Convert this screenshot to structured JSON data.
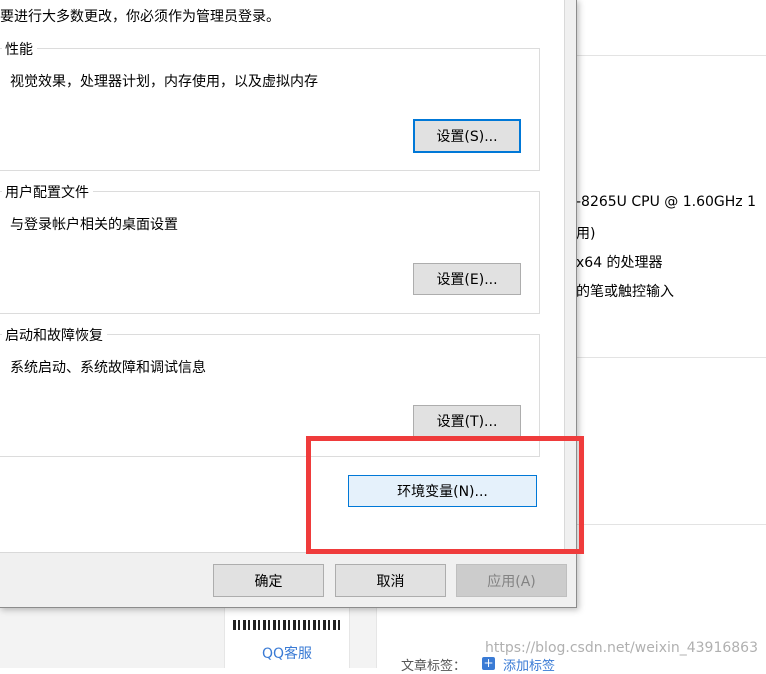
{
  "dialog": {
    "admin_note": "要进行大多数更改，你必须作为管理员登录。",
    "performance": {
      "title": "性能",
      "description": "视觉效果，处理器计划，内存使用，以及虚拟内存",
      "button": "设置(S)..."
    },
    "user_profiles": {
      "title": "用户配置文件",
      "description": "与登录帐户相关的桌面设置",
      "button": "设置(E)..."
    },
    "startup_recovery": {
      "title": "启动和故障恢复",
      "description": "系统启动、系统故障和调试信息",
      "button": "设置(T)..."
    },
    "env_button": "环境变量(N)...",
    "ok_button": "确定",
    "cancel_button": "取消",
    "apply_button": "应用(A)"
  },
  "background": {
    "cpu_line": "-8265U CPU @ 1.60GHz   1",
    "ram_suffix": "用)",
    "system_type": "x64 的处理器",
    "pen_touch": "的笔或触控输入"
  },
  "webpage": {
    "qq_service": "QQ客服",
    "article_tags_label": "文章标签：",
    "add_tag_icon": "+",
    "add_tag": "添加标签",
    "watermark": "https://blog.csdn.net/weixin_43916863"
  },
  "colors": {
    "highlight": "#ef3b3b",
    "accent": "#0078d7",
    "link": "#3a7bd5"
  }
}
